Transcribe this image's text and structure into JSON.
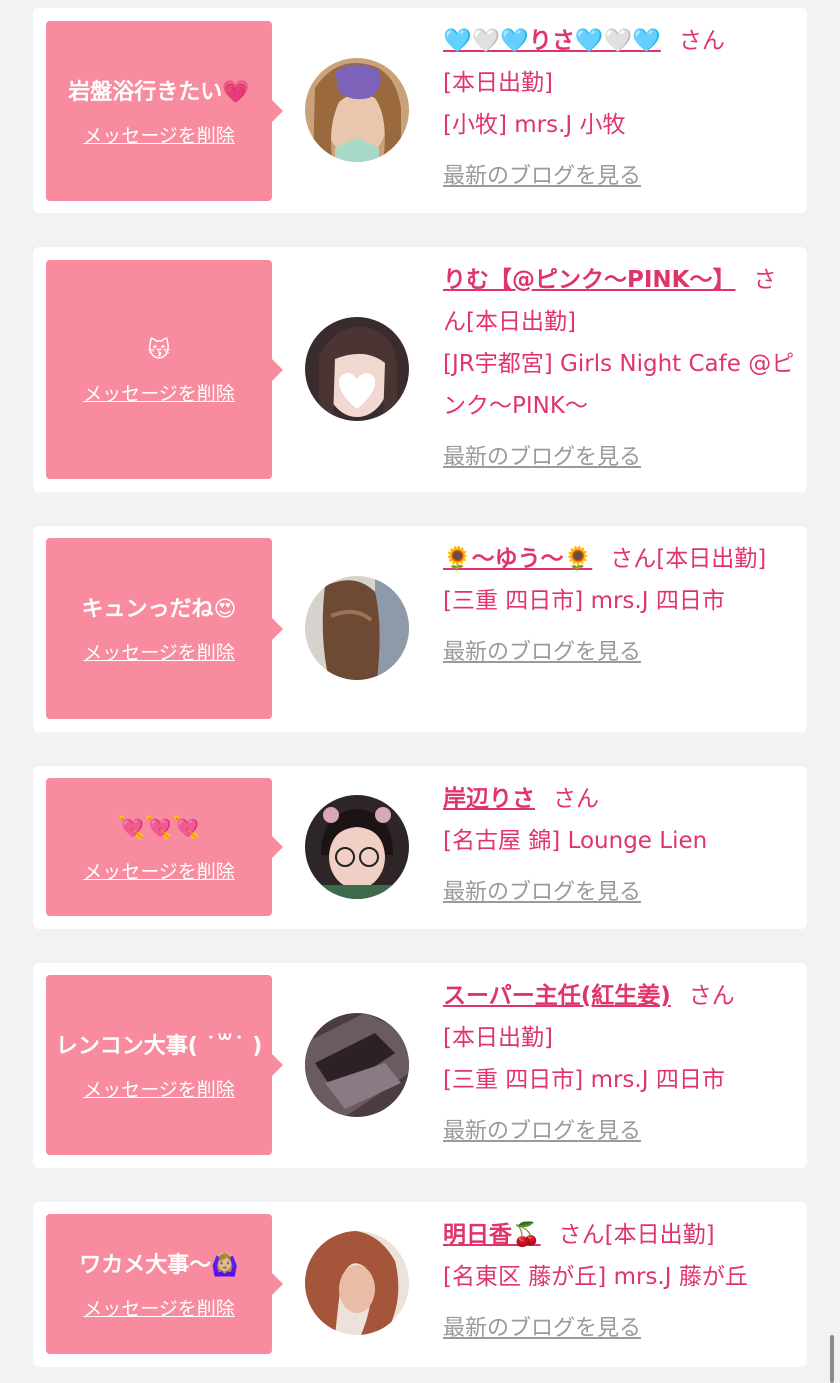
{
  "delete_label": "メッセージを削除",
  "blog_label": "最新のブログを見る",
  "san": "さん",
  "colors": {
    "accent": "#e0356a",
    "bubble": "#f88c9e",
    "background": "#f2f2f2"
  },
  "items": [
    {
      "message": "岩盤浴行きたい💗",
      "name": "🩵🤍🩵りさ🩵🤍🩵",
      "status": "[本日出勤]",
      "shop": "[小牧] mrs.J 小牧"
    },
    {
      "message": "😽",
      "name": "りむ【@ピンク〜PINK〜】",
      "status": "[本日出勤]",
      "shop": "[JR宇都宮] Girls Night Cafe @ピンク〜PINK〜"
    },
    {
      "message": "キュンっだね😍",
      "name": "🌻〜ゆう〜🌻",
      "status": "[本日出勤]",
      "shop": "[三重 四日市] mrs.J 四日市"
    },
    {
      "message": "💘💘💘",
      "name": "岸辺りさ",
      "status": "",
      "shop": "[名古屋 錦] Lounge Lien"
    },
    {
      "message": "レンコン大事( ˙꒳˙ )",
      "name": "スーパー主任(紅生姜)",
      "status": "[本日出勤]",
      "shop": "[三重 四日市] mrs.J 四日市"
    },
    {
      "message": "ワカメ大事〜🙆🏼‍♀️",
      "name": "明日香🍒",
      "status": "[本日出勤]",
      "shop": "[名東区 藤が丘] mrs.J 藤が丘"
    }
  ]
}
